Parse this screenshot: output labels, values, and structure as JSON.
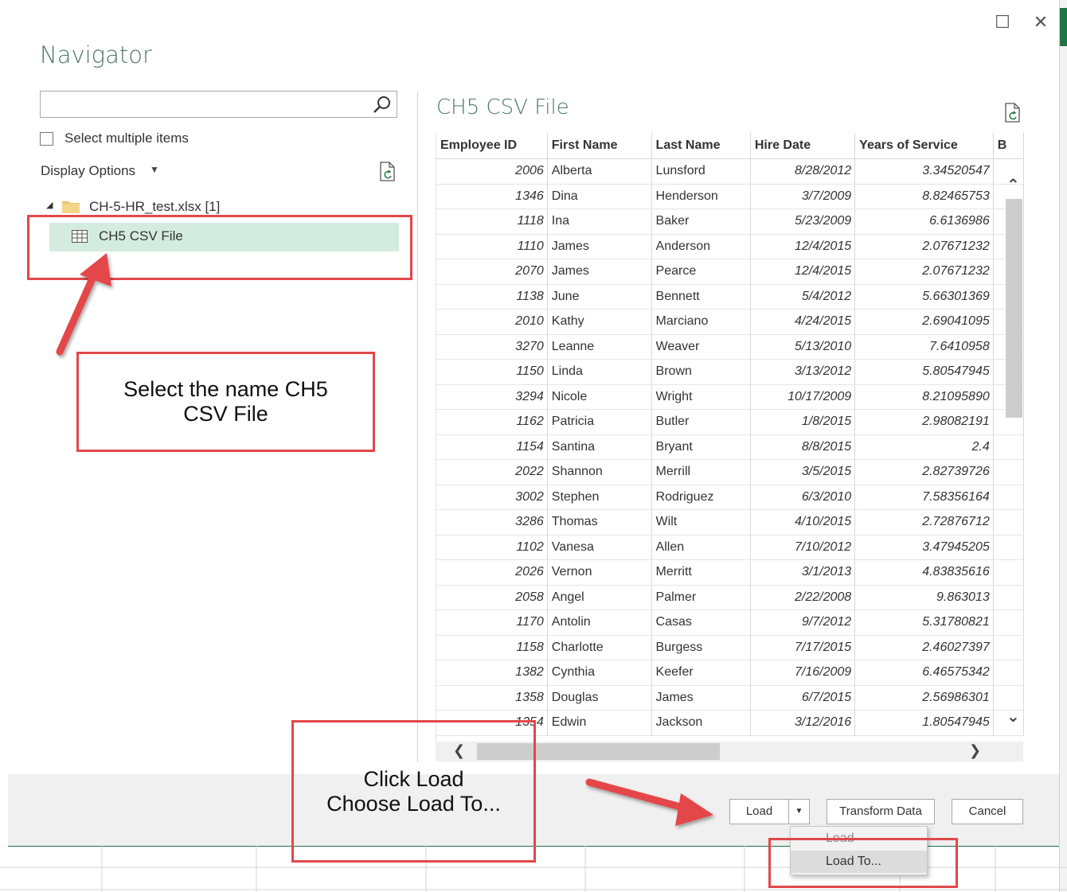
{
  "window": {
    "maximize_icon": "☐",
    "close_icon": "✕"
  },
  "navigator": {
    "title": "Navigator",
    "search": {
      "value": "",
      "placeholder": ""
    },
    "select_multiple_label": "Select multiple items",
    "display_options_label": "Display Options",
    "tree": {
      "file_label": "CH-5-HR_test.xlsx [1]",
      "items": [
        {
          "label": "CH5 CSV File",
          "selected": true
        }
      ]
    }
  },
  "preview": {
    "title": "CH5 CSV File",
    "columns": [
      "Employee ID",
      "First Name",
      "Last Name",
      "Hire Date",
      "Years of Service",
      "B"
    ],
    "rows": [
      [
        "2006",
        "Alberta",
        "Lunsford",
        "8/28/2012",
        "3.34520547"
      ],
      [
        "1346",
        "Dina",
        "Henderson",
        "3/7/2009",
        "8.82465753"
      ],
      [
        "1118",
        "Ina",
        "Baker",
        "5/23/2009",
        "6.6136986"
      ],
      [
        "1110",
        "James",
        "Anderson",
        "12/4/2015",
        "2.07671232"
      ],
      [
        "2070",
        "James",
        "Pearce",
        "12/4/2015",
        "2.07671232"
      ],
      [
        "1138",
        "June",
        "Bennett",
        "5/4/2012",
        "5.66301369"
      ],
      [
        "2010",
        "Kathy",
        "Marciano",
        "4/24/2015",
        "2.69041095"
      ],
      [
        "3270",
        "Leanne",
        "Weaver",
        "5/13/2010",
        "7.6410958"
      ],
      [
        "1150",
        "Linda",
        "Brown",
        "3/13/2012",
        "5.80547945"
      ],
      [
        "3294",
        "Nicole",
        "Wright",
        "10/17/2009",
        "8.21095890"
      ],
      [
        "1162",
        "Patricia",
        "Butler",
        "1/8/2015",
        "2.98082191"
      ],
      [
        "1154",
        "Santina",
        "Bryant",
        "8/8/2015",
        "2.4"
      ],
      [
        "2022",
        "Shannon",
        "Merrill",
        "3/5/2015",
        "2.82739726"
      ],
      [
        "3002",
        "Stephen",
        "Rodriguez",
        "6/3/2010",
        "7.58356164"
      ],
      [
        "3286",
        "Thomas",
        "Wilt",
        "4/10/2015",
        "2.72876712"
      ],
      [
        "1102",
        "Vanesa",
        "Allen",
        "7/10/2012",
        "3.47945205"
      ],
      [
        "2026",
        "Vernon",
        "Merritt",
        "3/1/2013",
        "4.83835616"
      ],
      [
        "2058",
        "Angel",
        "Palmer",
        "2/22/2008",
        "9.863013"
      ],
      [
        "1170",
        "Antolin",
        "Casas",
        "9/7/2012",
        "5.31780821"
      ],
      [
        "1158",
        "Charlotte",
        "Burgess",
        "7/17/2015",
        "2.46027397"
      ],
      [
        "1382",
        "Cynthia",
        "Keefer",
        "7/16/2009",
        "6.46575342"
      ],
      [
        "1358",
        "Douglas",
        "James",
        "6/7/2015",
        "2.56986301"
      ],
      [
        "1354",
        "Edwin",
        "Jackson",
        "3/12/2016",
        "1.80547945"
      ]
    ]
  },
  "footer": {
    "load_label": "Load",
    "transform_label": "Transform Data",
    "cancel_label": "Cancel",
    "dropdown_menu": [
      "Load",
      "Load To..."
    ]
  },
  "annotations": {
    "callout_select": [
      "Select the name CH5",
      "CSV File"
    ],
    "callout_load": [
      "Click Load",
      "Choose Load To..."
    ],
    "accent_color": "#e3474a"
  }
}
